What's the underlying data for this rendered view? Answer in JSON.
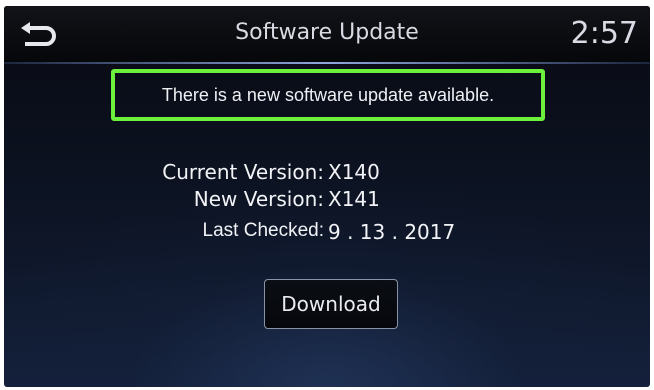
{
  "header": {
    "back_icon": "back-arrow-icon",
    "title": "Software Update",
    "clock": "2:57"
  },
  "notice": {
    "text": "There is a new software update available.",
    "border_color": "#6cf23c"
  },
  "info": {
    "current_version_label": "Current Version:",
    "current_version_value": "X140",
    "new_version_label": "New Version:",
    "new_version_value": "X141",
    "last_checked_label": "Last Checked:",
    "last_checked_value": "9 . 13 . 2017"
  },
  "actions": {
    "download_label": "Download"
  }
}
